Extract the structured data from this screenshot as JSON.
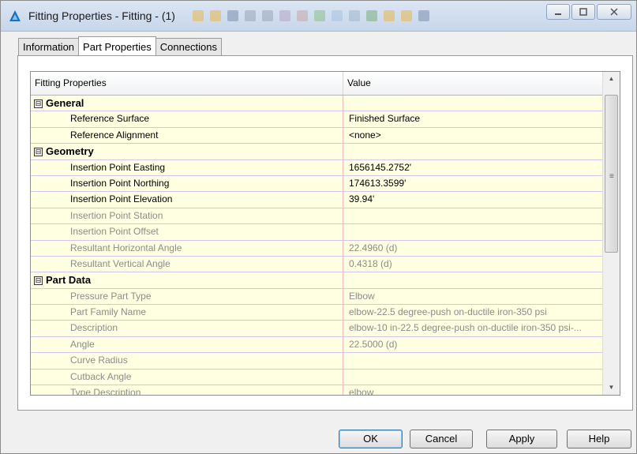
{
  "window": {
    "title": "Fitting Properties - Fitting - (1)",
    "controls": [
      "minimize-icon",
      "maximize-icon",
      "close-icon"
    ]
  },
  "tabs": [
    {
      "label": "Information",
      "active": false
    },
    {
      "label": "Part Properties",
      "active": true
    },
    {
      "label": "Connections",
      "active": false
    }
  ],
  "grid": {
    "columns": {
      "name": "Fitting Properties",
      "value": "Value"
    },
    "rows": [
      {
        "type": "category",
        "expand": "⊟",
        "label": "General"
      },
      {
        "type": "property",
        "label": "Reference Surface",
        "value": "Finished Surface",
        "enabled": true
      },
      {
        "type": "property",
        "label": "Reference Alignment",
        "value": "<none>",
        "enabled": true
      },
      {
        "type": "category",
        "expand": "⊟",
        "label": "Geometry"
      },
      {
        "type": "property",
        "label": "Insertion Point Easting",
        "value": "1656145.2752'",
        "enabled": true
      },
      {
        "type": "property",
        "label": "Insertion Point Northing",
        "value": "174613.3599'",
        "enabled": true
      },
      {
        "type": "property",
        "label": "Insertion Point Elevation",
        "value": "39.94'",
        "enabled": true
      },
      {
        "type": "property",
        "label": "Insertion Point Station",
        "value": "",
        "enabled": false
      },
      {
        "type": "property",
        "label": "Insertion Point Offset",
        "value": "",
        "enabled": false
      },
      {
        "type": "property",
        "label": "Resultant Horizontal Angle",
        "value": "22.4960 (d)",
        "enabled": false
      },
      {
        "type": "property",
        "label": "Resultant Vertical Angle",
        "value": "0.4318 (d)",
        "enabled": false
      },
      {
        "type": "category",
        "expand": "⊟",
        "label": "Part Data"
      },
      {
        "type": "property",
        "label": "Pressure Part Type",
        "value": "Elbow",
        "enabled": false
      },
      {
        "type": "property",
        "label": "Part Family Name",
        "value": "elbow-22.5 degree-push on-ductile iron-350 psi",
        "enabled": false
      },
      {
        "type": "property",
        "label": "Description",
        "value": "elbow-10 in-22.5 degree-push on-ductile iron-350 psi-...",
        "enabled": false
      },
      {
        "type": "property",
        "label": "Angle",
        "value": "22.5000 (d)",
        "enabled": false
      },
      {
        "type": "property",
        "label": "Curve Radius",
        "value": "",
        "enabled": false
      },
      {
        "type": "property",
        "label": "Cutback Angle",
        "value": "",
        "enabled": false
      },
      {
        "type": "property",
        "label": "Type Description",
        "value": "elbow",
        "enabled": false
      }
    ]
  },
  "scroll": {
    "up": "▲",
    "down": "▼",
    "grip": "≡"
  },
  "buttons": {
    "ok": "OK",
    "cancel": "Cancel",
    "apply": "Apply",
    "help": "Help"
  },
  "colors": {
    "grid_background": "#ffffe1",
    "row_separator": "#d6c4ee",
    "column_separator": "#f2b9b9",
    "disabled_text": "#8c8c8c"
  }
}
